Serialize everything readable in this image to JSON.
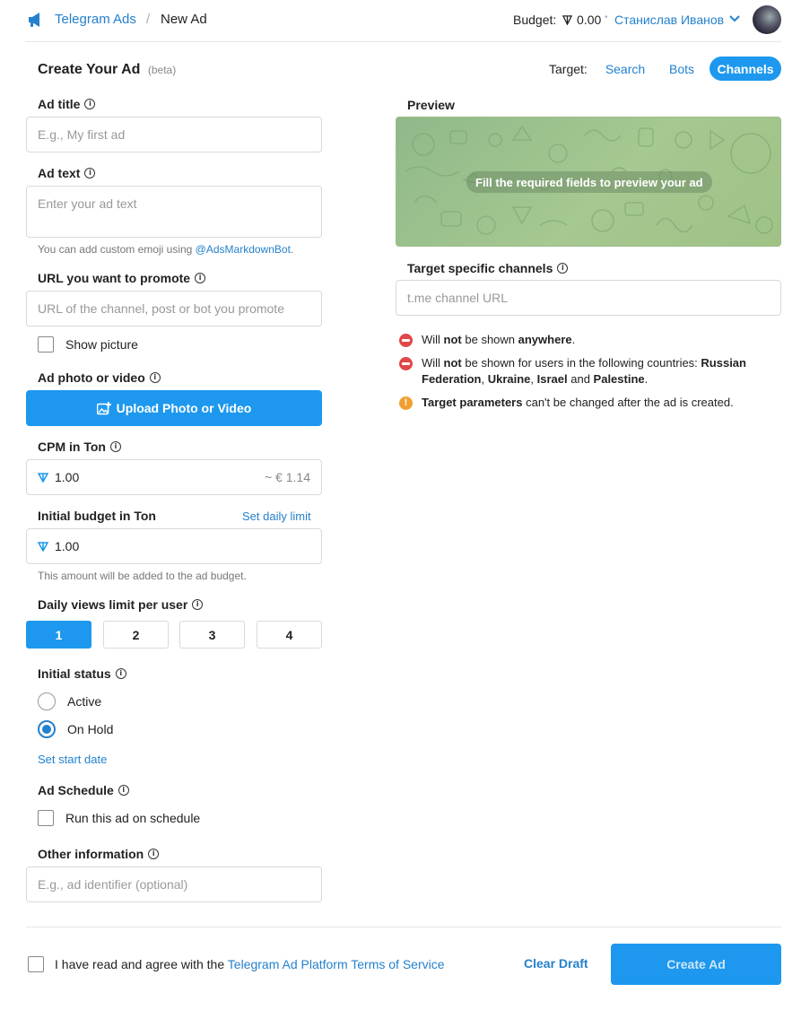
{
  "header": {
    "brand": "Telegram Ads",
    "separator": "/",
    "current_page": "New Ad",
    "budget_label": "Budget:",
    "budget_value": "0.00",
    "user_name": "Станислав Иванов",
    "icons": [
      "megaphone-icon",
      "ton-icon",
      "chevron-down-icon",
      "avatar"
    ]
  },
  "form": {
    "title": "Create Your Ad",
    "beta": "(beta)",
    "ad_title": {
      "label": "Ad title",
      "placeholder": "E.g., My first ad"
    },
    "ad_text": {
      "label": "Ad text",
      "placeholder": "Enter your ad text",
      "hint_prefix": "You can add custom emoji using ",
      "hint_link": "@AdsMarkdownBot",
      "hint_suffix": "."
    },
    "url": {
      "label": "URL you want to promote",
      "placeholder": "URL of the channel, post or bot you promote"
    },
    "show_picture": "Show picture",
    "media": {
      "label": "Ad photo or video",
      "button": "Upload Photo or Video"
    },
    "cpm": {
      "label": "CPM in Ton",
      "value": "1.00",
      "conversion": "~ € 1.14"
    },
    "budget": {
      "label": "Initial budget in Ton",
      "daily_link": "Set daily limit",
      "value": "1.00",
      "hint": "This amount will be added to the ad budget."
    },
    "daily_views": {
      "label": "Daily views limit per user",
      "options": [
        "1",
        "2",
        "3",
        "4"
      ],
      "selected": "1"
    },
    "initial_status": {
      "label": "Initial status",
      "options": [
        "Active",
        "On Hold"
      ],
      "selected": "On Hold",
      "start_date_link": "Set start date"
    },
    "schedule": {
      "label": "Ad Schedule",
      "checkbox": "Run this ad on schedule"
    },
    "other_info": {
      "label": "Other information",
      "placeholder": "E.g., ad identifier (optional)"
    }
  },
  "targeting": {
    "label": "Target:",
    "tabs": [
      "Search",
      "Bots",
      "Channels"
    ],
    "active_tab": "Channels",
    "preview_label": "Preview",
    "preview_message": "Fill the required fields to preview your ad",
    "channels_label": "Target specific channels",
    "channels_placeholder": "t.me channel URL",
    "notes": {
      "n1_a": "Will ",
      "n1_b": "not",
      "n1_c": " be shown ",
      "n1_d": "anywhere",
      "n1_e": ".",
      "n2_a": "Will ",
      "n2_b": "not",
      "n2_c": " be shown for users in the following countries: ",
      "n2_d": "Russian",
      "n2_e": "Federation",
      "n2_f": ", ",
      "n2_g": "Ukraine",
      "n2_h": ", ",
      "n2_i": "Israel",
      "n2_j": " and ",
      "n2_k": "Palestine",
      "n2_l": ".",
      "n3_a": "Target parameters",
      "n3_b": " can't be changed after the ad is created."
    }
  },
  "footer": {
    "agree_prefix": "I have read and agree with the ",
    "agree_link": "Telegram Ad Platform Terms of Service",
    "clear_draft": "Clear Draft",
    "create": "Create Ad"
  },
  "colors": {
    "accent": "#1d98ee",
    "link": "#2481cc",
    "error": "#e04848",
    "warning": "#f0a030",
    "preview_bg": "#a6c891"
  }
}
